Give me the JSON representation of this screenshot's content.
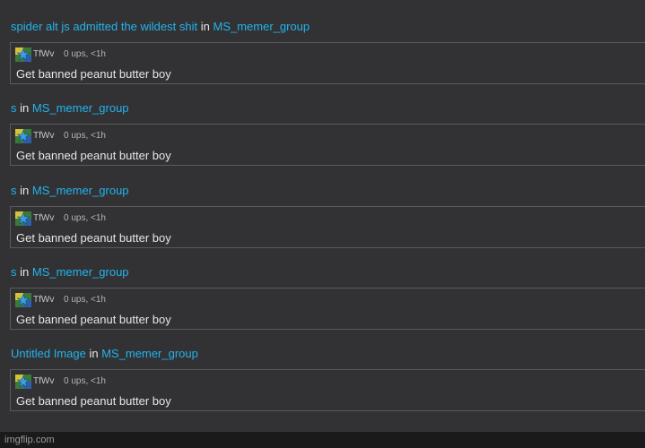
{
  "feed": {
    "entries": [
      {
        "title": "spider alt js admitted the wildest shit",
        "in_word": "in",
        "group": "MS_memer_group",
        "comment": {
          "username": "TfWv",
          "meta": "0 ups, <1h",
          "text": "Get banned peanut butter boy",
          "avatar_icon": "star-avatar-icon"
        }
      },
      {
        "title": "s",
        "in_word": "in",
        "group": "MS_memer_group",
        "comment": {
          "username": "TfWv",
          "meta": "0 ups, <1h",
          "text": "Get banned peanut butter boy",
          "avatar_icon": "star-avatar-icon"
        }
      },
      {
        "title": "s",
        "in_word": "in",
        "group": "MS_memer_group",
        "comment": {
          "username": "TfWv",
          "meta": "0 ups, <1h",
          "text": "Get banned peanut butter boy",
          "avatar_icon": "star-avatar-icon"
        }
      },
      {
        "title": "s",
        "in_word": "in",
        "group": "MS_memer_group",
        "comment": {
          "username": "TfWv",
          "meta": "0 ups, <1h",
          "text": "Get banned peanut butter boy",
          "avatar_icon": "star-avatar-icon"
        }
      },
      {
        "title": "Untitled Image",
        "in_word": "in",
        "group": "MS_memer_group",
        "comment": {
          "username": "TfWv",
          "meta": "0 ups, <1h",
          "text": "Get banned peanut butter boy",
          "avatar_icon": "star-avatar-icon"
        }
      }
    ]
  },
  "watermark": {
    "text": "imgflip.com"
  },
  "colors": {
    "background": "#323234",
    "link": "#23b3ec",
    "text": "#e6e6e6",
    "border": "#5a5a5c",
    "footer_strip": "#1a1a1a"
  }
}
